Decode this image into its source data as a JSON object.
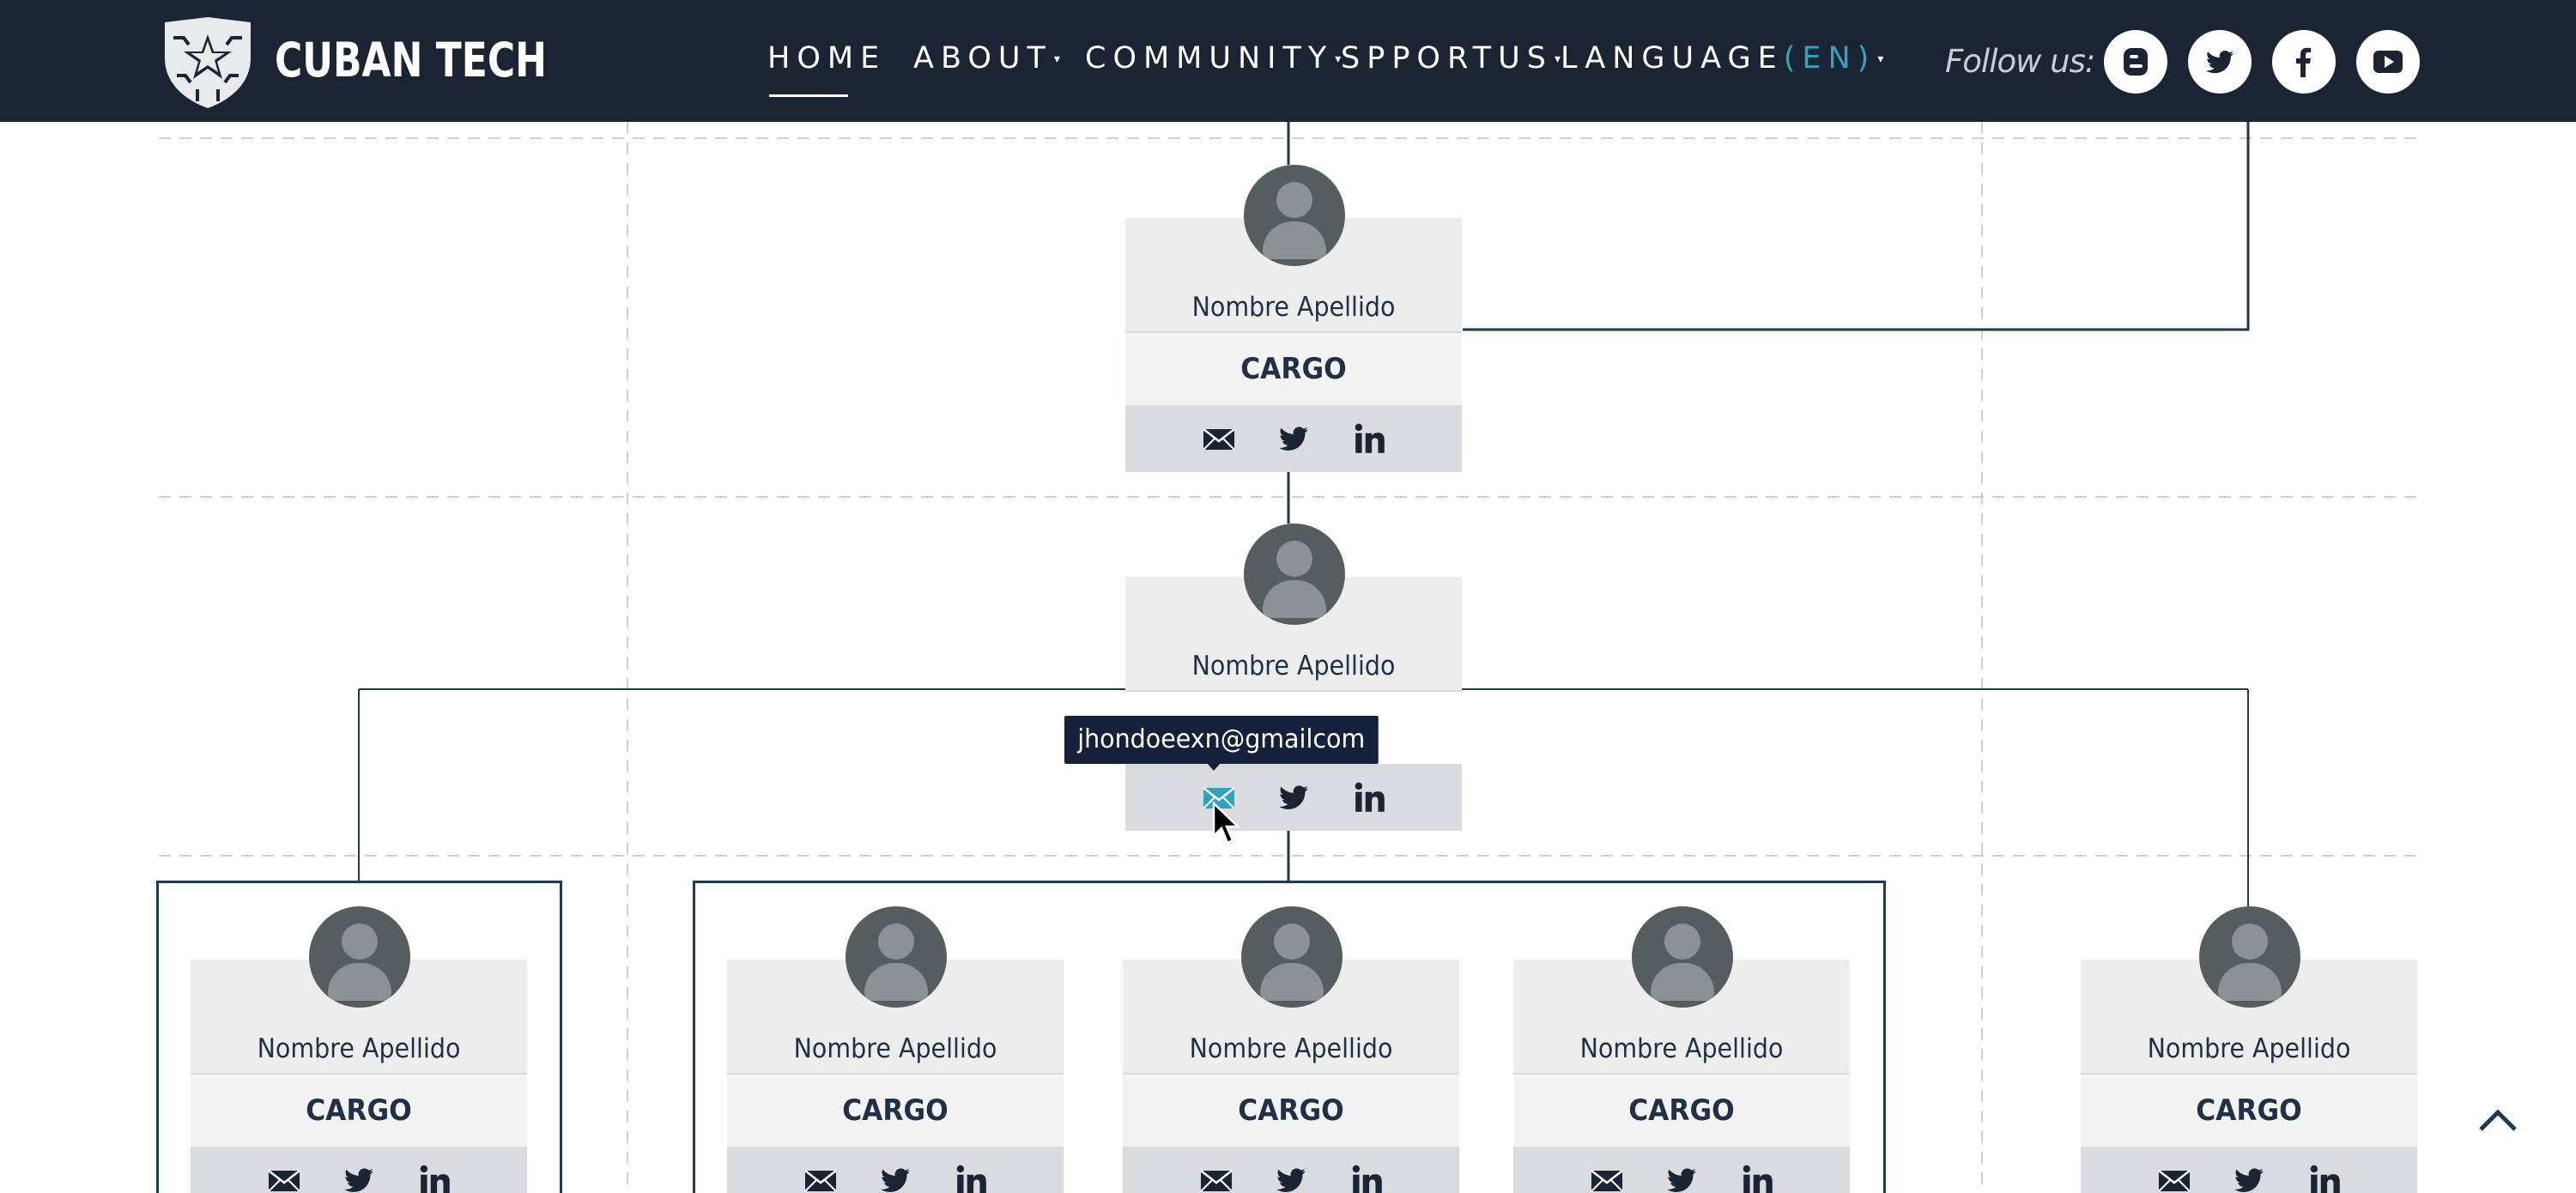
{
  "brand": {
    "name": "CUBAN TECH",
    "logo_icon": "star-shield-icon"
  },
  "nav": {
    "home": "HOME",
    "about": "ABOUT",
    "community": "COMMUNITY",
    "spportus": "SPPORTUS",
    "language": "LANGUAGE",
    "language_code": "(EN)",
    "caret": "▾"
  },
  "follow": {
    "label": "Follow us:",
    "icons": [
      "blogger-icon",
      "twitter-icon",
      "facebook-icon",
      "youtube-icon"
    ]
  },
  "member": {
    "name": "Nombre Apellido",
    "role": "CARGO"
  },
  "tooltip": {
    "text": "jhondoeexn@gmailcom"
  },
  "colors": {
    "header_bg": "#1b2433",
    "accent": "#2fa3c0",
    "navy": "#1f3047",
    "line": "#1f3a55"
  }
}
